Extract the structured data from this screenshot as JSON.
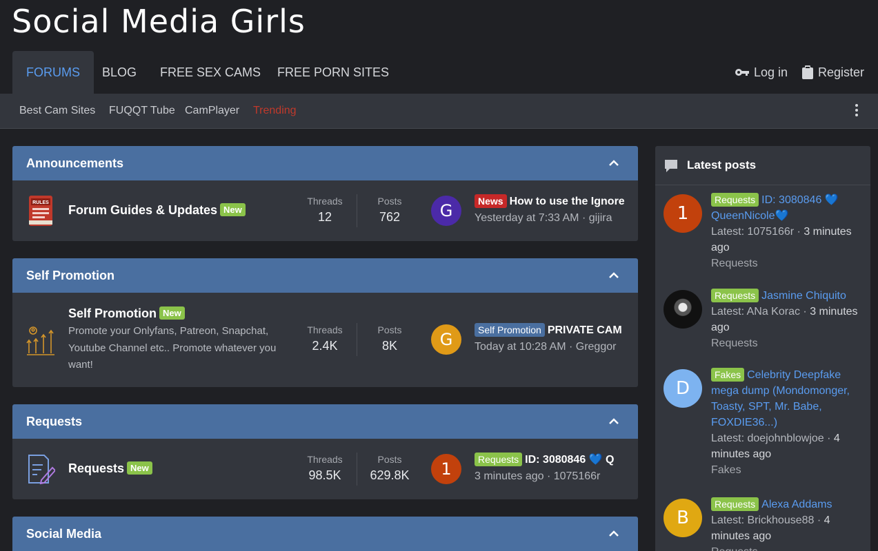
{
  "site": {
    "title": "Social Media Girls"
  },
  "nav": {
    "tabs": [
      {
        "label": "FORUMS"
      },
      {
        "label": "BLOG"
      },
      {
        "label": "FREE SEX CAMS"
      },
      {
        "label": "FREE PORN SITES"
      }
    ],
    "login": "Log in",
    "register": "Register"
  },
  "subnav": {
    "items": [
      {
        "label": "Best Cam Sites"
      },
      {
        "label": "FUQQT Tube"
      },
      {
        "label": "CamPlayer"
      },
      {
        "label": "Trending"
      }
    ]
  },
  "categories": [
    {
      "title": "Announcements",
      "forum": {
        "title": "Forum Guides & Updates",
        "badge": "New",
        "icon": "rules-book-icon",
        "threads_label": "Threads",
        "threads": "12",
        "posts_label": "Posts",
        "posts": "762",
        "avatar": "G",
        "avatar_color": "#4b2aa8",
        "last_prefix": "News",
        "last_title": "How to use the Ignore",
        "last_meta": "Yesterday at 7:33 AM · gijira"
      }
    },
    {
      "title": "Self Promotion",
      "forum": {
        "title": "Self Promotion",
        "badge": "New",
        "icon": "growth-chart-icon",
        "description": "Promote your Onlyfans, Patreon, Snapchat, Youtube Channel etc.. Promote whatever you want!",
        "threads_label": "Threads",
        "threads": "2.4K",
        "posts_label": "Posts",
        "posts": "8K",
        "avatar": "G",
        "avatar_color": "#e09a17",
        "last_prefix": "Self Promotion",
        "last_title": "PRIVATE CAM",
        "last_meta": "Today at 10:28 AM · Greggor"
      }
    },
    {
      "title": "Requests",
      "forum": {
        "title": "Requests",
        "badge": "New",
        "icon": "document-edit-icon",
        "threads_label": "Threads",
        "threads": "98.5K",
        "posts_label": "Posts",
        "posts": "629.8K",
        "avatar": "1",
        "avatar_color": "#c2410c",
        "last_prefix": "Requests",
        "last_title": "ID: 3080846 💙 Q",
        "last_meta": "3 minutes ago · 1075166r"
      }
    },
    {
      "title": "Social Media"
    }
  ],
  "sidebar": {
    "title": "Latest posts",
    "posts": [
      {
        "avatar": "1",
        "avatar_color": "#c2410c",
        "prefix": "Requests",
        "title_a": "ID: 3080846 ",
        "heart": "💙",
        "title_b": "QueenNicole",
        "heart2": "💙",
        "latest_label": "Latest: 1075166r",
        "time": "3 minutes ago",
        "forum": "Requests"
      },
      {
        "avatar": "",
        "avatar_color": "#111111",
        "prefix": "Requests",
        "title_a": "Jasmine Chiquito",
        "latest_label": "Latest: ANa Korac",
        "time": "3 minutes ago",
        "forum": "Requests"
      },
      {
        "avatar": "D",
        "avatar_color": "#7db3f0",
        "prefix": "Fakes",
        "title_a": "Celebrity Deepfake mega dump (Mondomonger, Toasty, SPT, Mr. Babe, FOXDIE36...)",
        "latest_label": "Latest: doejohnblowjoe",
        "time": "4 minutes ago",
        "forum": "Fakes"
      },
      {
        "avatar": "B",
        "avatar_color": "#e0a812",
        "prefix": "Requests",
        "title_a": "Alexa Addams",
        "latest_label": "Latest: Brickhouse88",
        "time": "4 minutes ago",
        "forum": "Requests"
      }
    ]
  }
}
